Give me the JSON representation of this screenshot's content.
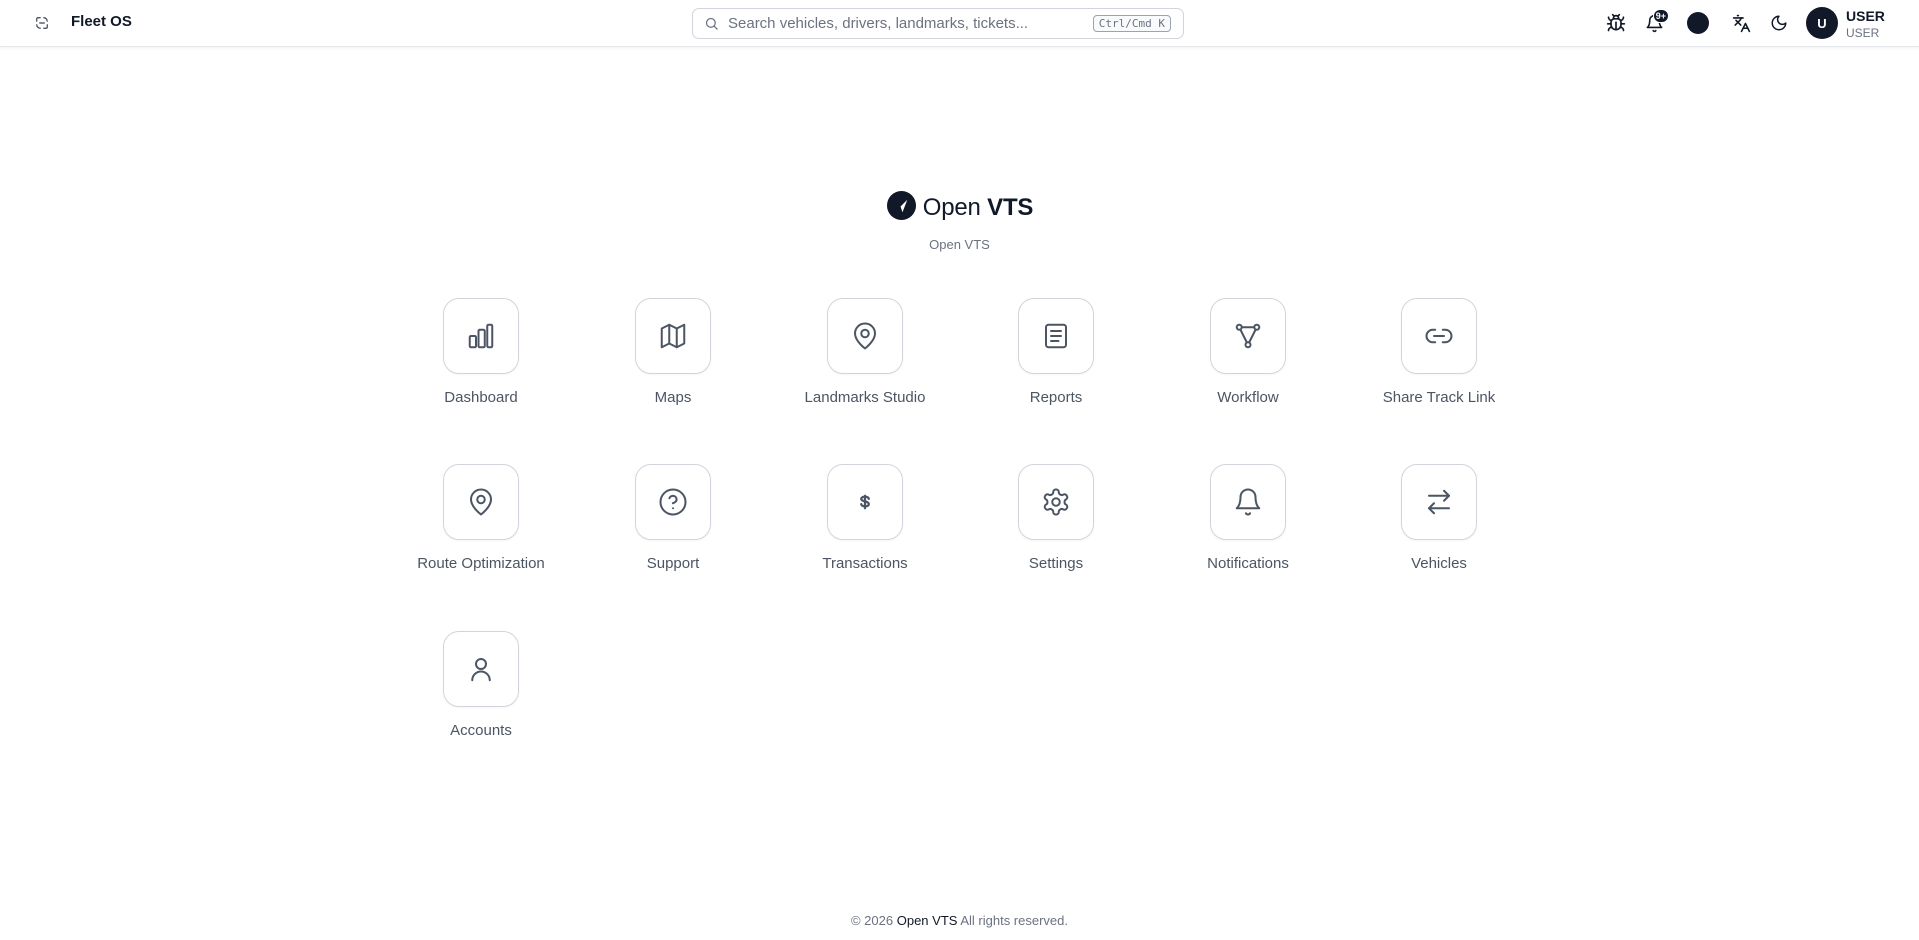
{
  "header": {
    "app_title": "Fleet OS",
    "search_placeholder": "Search vehicles, drivers, landmarks, tickets...",
    "search_shortcut": "Ctrl/Cmd K",
    "notification_badge": "9+",
    "user_initial": "U",
    "user_name": "USER",
    "user_role": "USER"
  },
  "brand": {
    "name_prefix": "Open",
    "name_suffix": "VTS",
    "subtitle": "Open VTS"
  },
  "apps": [
    {
      "label": "Dashboard",
      "icon": "bar-chart-icon"
    },
    {
      "label": "Maps",
      "icon": "map-icon"
    },
    {
      "label": "Landmarks Studio",
      "icon": "map-pin-icon"
    },
    {
      "label": "Reports",
      "icon": "document-icon"
    },
    {
      "label": "Workflow",
      "icon": "workflow-icon"
    },
    {
      "label": "Share Track Link",
      "icon": "link-icon"
    },
    {
      "label": "Route Optimization",
      "icon": "map-pin-icon"
    },
    {
      "label": "Support",
      "icon": "help-circle-icon"
    },
    {
      "label": "Transactions",
      "icon": "dollar-icon"
    },
    {
      "label": "Settings",
      "icon": "gear-icon"
    },
    {
      "label": "Notifications",
      "icon": "bell-icon"
    },
    {
      "label": "Vehicles",
      "icon": "arrows-exchange-icon"
    },
    {
      "label": "Accounts",
      "icon": "user-icon"
    }
  ],
  "footer": {
    "copyright": "© 2026",
    "brand": "Open VTS",
    "rights": "All rights reserved."
  },
  "colors": {
    "primary": "#111827",
    "muted_text": "#6b7280",
    "border": "#d1d5db"
  }
}
